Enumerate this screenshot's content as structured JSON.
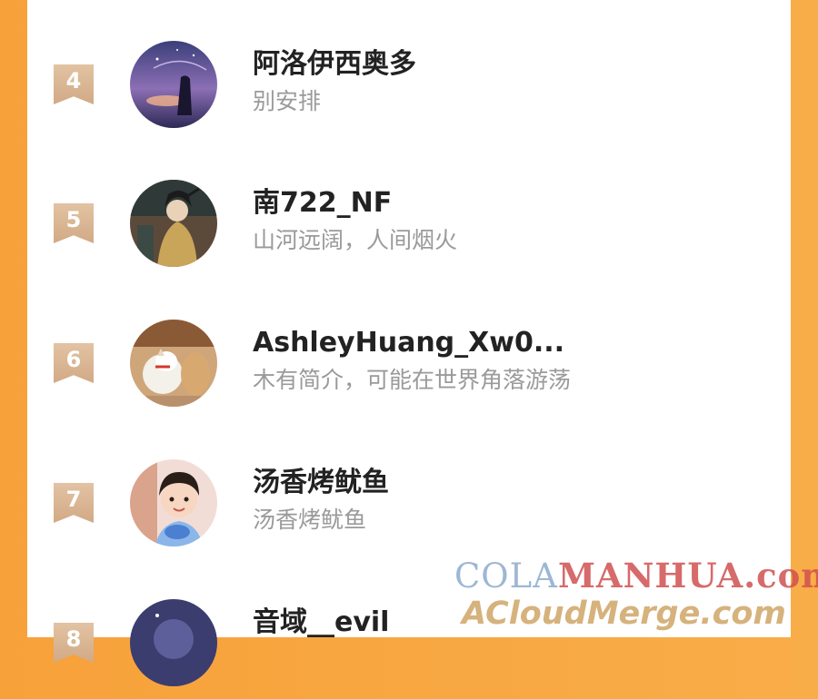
{
  "ranking": [
    {
      "rank": "4",
      "name": "阿洛伊西奥多",
      "bio": "别安排"
    },
    {
      "rank": "5",
      "name": "南722_NF",
      "bio": "山河远阔，人间烟火"
    },
    {
      "rank": "6",
      "name": "AshleyHuang_Xw0...",
      "bio": "木有简介，可能在世界角落游荡"
    },
    {
      "rank": "7",
      "name": "汤香烤鱿鱼",
      "bio": "汤香烤鱿鱼"
    },
    {
      "rank": "8",
      "name": "音域__evil",
      "bio": ""
    }
  ],
  "watermark": {
    "line1_a": "COLA",
    "line1_b": "MANHUA.com",
    "line2": "ACloudMerge.com"
  },
  "colors": {
    "background": "#f7a13a",
    "card": "#ffffff",
    "rank_badge": "#d8b08c",
    "name_text": "#222222",
    "bio_text": "#9a9a9a"
  }
}
